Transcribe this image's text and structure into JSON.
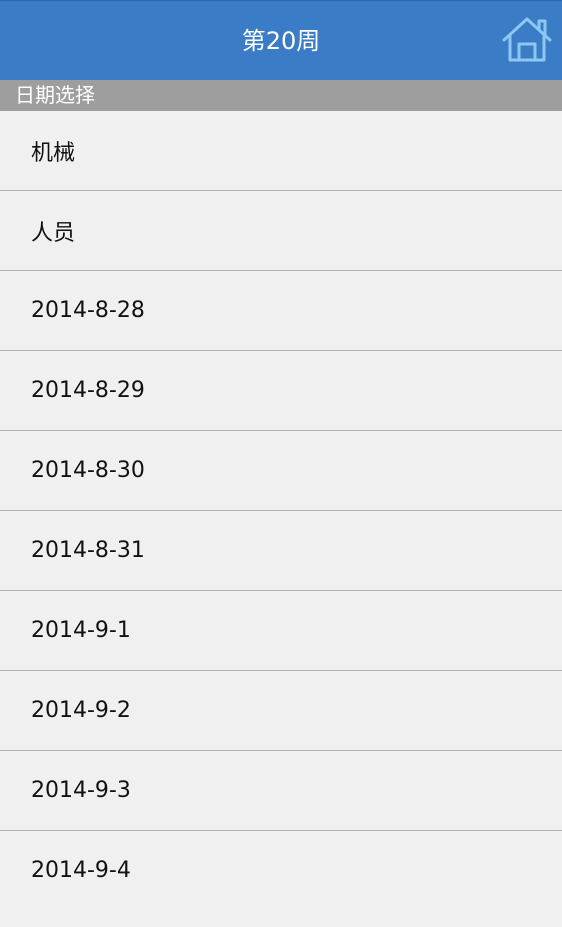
{
  "header": {
    "title": "第20周",
    "home_icon": "home-icon"
  },
  "section": {
    "label": "日期选择"
  },
  "list": {
    "items": [
      {
        "label": "机械"
      },
      {
        "label": "人员"
      },
      {
        "label": "2014-8-28"
      },
      {
        "label": "2014-8-29"
      },
      {
        "label": "2014-8-30"
      },
      {
        "label": "2014-8-31"
      },
      {
        "label": "2014-9-1"
      },
      {
        "label": "2014-9-2"
      },
      {
        "label": "2014-9-3"
      },
      {
        "label": "2014-9-4"
      }
    ]
  },
  "colors": {
    "titlebar": "#3a7cc5",
    "section_header": "#9e9e9e",
    "background": "#f0f0f0",
    "divider": "#b4b4b4"
  }
}
